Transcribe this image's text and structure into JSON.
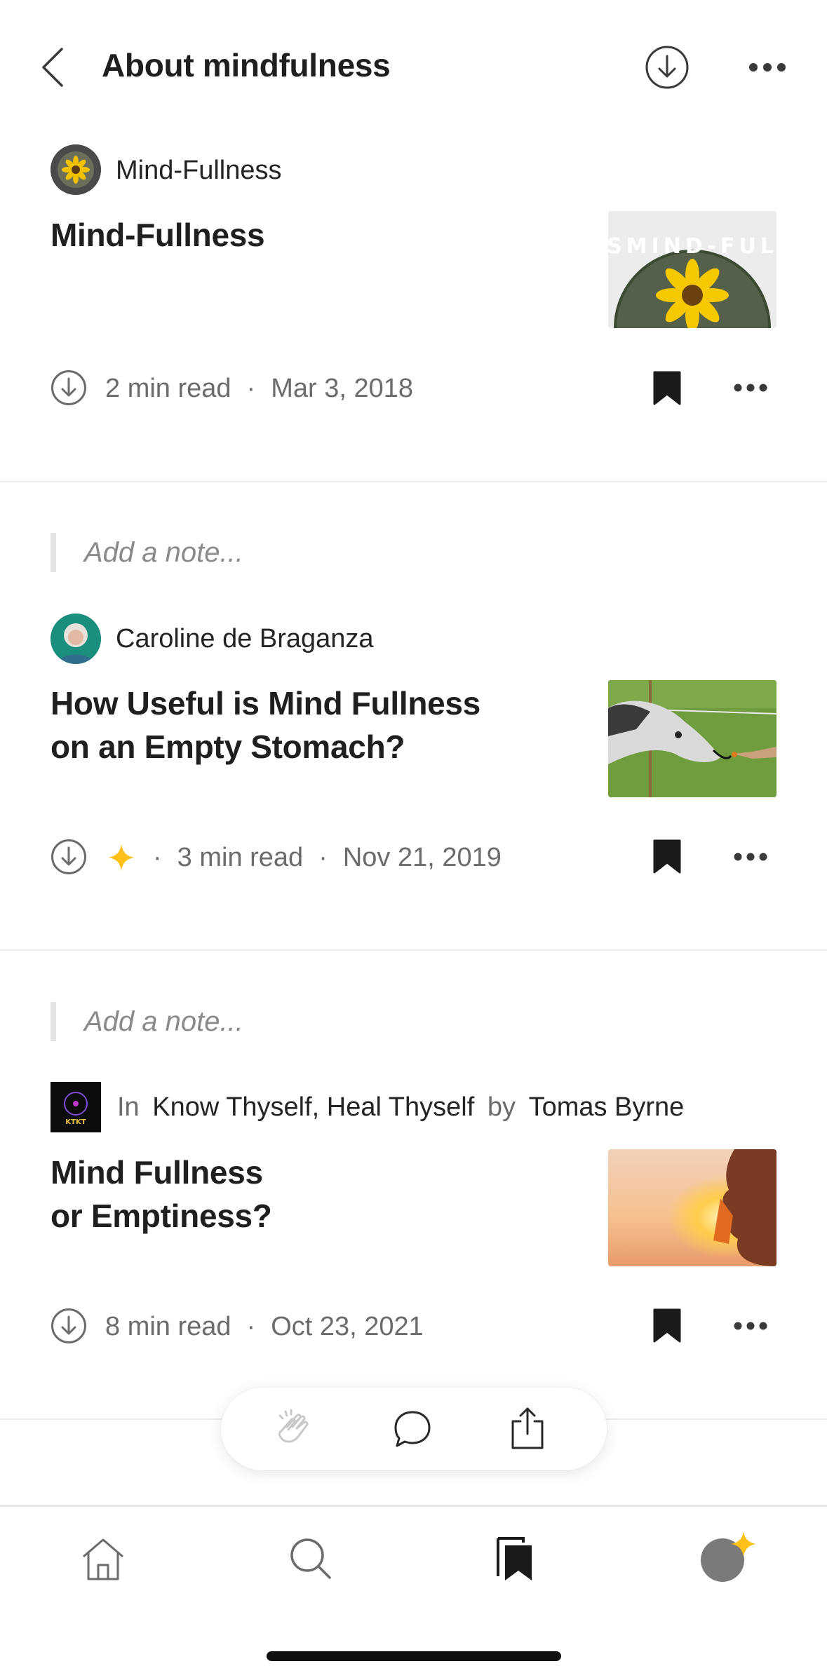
{
  "header": {
    "title": "About mindfulness"
  },
  "articles": [
    {
      "author": "Mind-Fullness",
      "title_line1": "Mind-Fullness",
      "title_line2": "",
      "read_time": "2 min read",
      "date": "Mar 3, 2018"
    },
    {
      "note_placeholder": "Add a note...",
      "author": "Caroline de Braganza",
      "title_line1": "How Useful is Mind Fullness",
      "title_line2": "on an Empty Stomach?",
      "read_time": "3 min read",
      "date": "Nov 21, 2019",
      "member_only": true
    },
    {
      "note_placeholder": "Add a note...",
      "in_label": "In",
      "publication": "Know Thyself, Heal Thyself",
      "by_label": "by",
      "author": "Tomas Byrne",
      "publication_logo_text": "KTKT",
      "title_line1": "Mind Fullness",
      "title_line2": "or Emptiness?",
      "read_time": "8 min read",
      "date": "Oct 23, 2021"
    }
  ],
  "thumb1_text": "SMIND-FUL",
  "colors": {
    "accent_star": "#FFC017",
    "bookmark": "#1a1a1a",
    "muted": "#6b6b6b"
  },
  "icons": [
    "back-chevron-icon",
    "download-icon",
    "more-icon",
    "bookmark-icon",
    "star-icon",
    "clap-icon",
    "comment-icon",
    "share-icon",
    "home-icon",
    "search-icon",
    "library-icon"
  ]
}
